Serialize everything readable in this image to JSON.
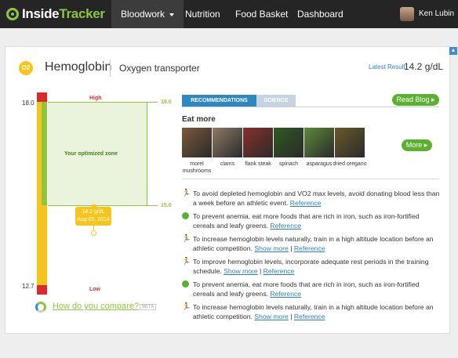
{
  "nav": {
    "logo_inside": "Inside",
    "logo_tracker": "Tracker",
    "items": [
      "Bloodwork",
      "Nutrition",
      "Food Basket",
      "Dashboard"
    ],
    "user_name": "Ken Lubin"
  },
  "biomarker": {
    "badge": "O2",
    "name": "Hemoglobin",
    "subtitle": "Oxygen transporter",
    "latest_label": "Latest Result",
    "latest_value": "14.2 g/dL"
  },
  "gauge": {
    "tick_high": "18.0",
    "tick_low": "12.7",
    "high_label": "High",
    "low_label": "Low",
    "zone_label": "Your optimized zone",
    "zone_top": "18.0",
    "zone_bottom": "15.0",
    "marker_value": "14.2 g/dL",
    "marker_date": "Aug 05, 2014",
    "compare_link": "How do you compare?",
    "beta": "BETA"
  },
  "tabs": [
    "RECOMMENDATIONS",
    "SCIENCE"
  ],
  "read_blog": "Read Blog ▸",
  "eat_more": {
    "title": "Eat more",
    "foods": [
      {
        "label": "morel mushrooms",
        "color": "#7a5a3a"
      },
      {
        "label": "clams",
        "color": "#8d7a66"
      },
      {
        "label": "flank steak",
        "color": "#8b2f2a"
      },
      {
        "label": "spinach",
        "color": "#2f5a22"
      },
      {
        "label": "asparagus",
        "color": "#5f8a3a"
      },
      {
        "label": "dried oregano",
        "color": "#6a5a2a"
      }
    ],
    "more_button": "More ▸"
  },
  "recommendations": [
    {
      "icon": "running-icon",
      "text": "To avoid depleted hemoglobin and VO2 max levels, avoid donating blood less than a week before an athletic event.",
      "links": [
        "Reference"
      ]
    },
    {
      "icon": "apple-icon",
      "text": "To prevent anemia, eat more foods that are rich in iron, such as iron-fortified cereals and leafy greens.",
      "links": [
        "Reference"
      ]
    },
    {
      "icon": "running-icon",
      "text": "To increase hemoglobin levels naturally, train in a high altitude location before an athletic competition.",
      "links": [
        "Show more",
        "Reference"
      ]
    },
    {
      "icon": "running-icon",
      "text": "To improve hemoglobin levels, incorporate adequate rest periods in the training schedule.",
      "links": [
        "Show more",
        "Reference"
      ]
    },
    {
      "icon": "apple-icon",
      "text": "To prevent anemia, eat more foods that are rich in iron, such as iron-fortified cereals and leafy greens.",
      "links": [
        "Reference"
      ]
    },
    {
      "icon": "running-icon",
      "text": "To increase hemoglobin levels naturally, train in a high altitude location before an athletic competition.",
      "links": [
        "Show more",
        "Reference"
      ]
    }
  ],
  "colors": {
    "accent_green": "#8dc63f",
    "accent_blue": "#2e88bf",
    "warn_yellow": "#f7c41b",
    "danger_red": "#d92b2b"
  }
}
